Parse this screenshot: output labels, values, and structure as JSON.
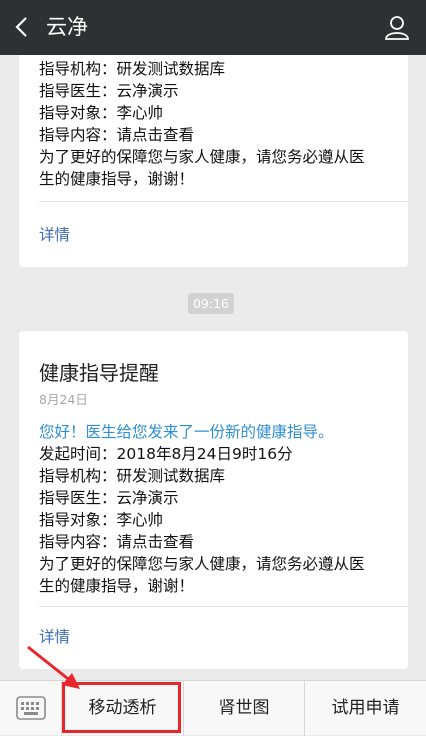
{
  "header": {
    "title": "云净"
  },
  "card1": {
    "lines": [
      "指导机构：研发测试数据库",
      "指导医生：云净演示",
      "指导对象：李心帅",
      "指导内容：请点击查看",
      "为了更好的保障您与家人健康，请您务必遵从医",
      "生的健康指导，谢谢！"
    ],
    "detail": "详情"
  },
  "timestamp": "09:16",
  "card2": {
    "title": "健康指导提醒",
    "date": "8月24日",
    "greeting": "您好！医生给您发来了一份新的健康指导。",
    "lines": [
      "发起时间：2018年8月24日9时16分",
      "指导机构：研发测试数据库",
      "指导医生：云净演示",
      "指导对象：李心帅",
      "指导内容：请点击查看",
      "为了更好的保障您与家人健康，请您务必遵从医",
      "生的健康指导，谢谢！"
    ],
    "detail": "详情"
  },
  "bottom_menu": {
    "items": [
      "移动透析",
      "肾世图",
      "试用申请"
    ]
  },
  "colors": {
    "header_bg": "#2f3033",
    "link": "#3c6cb8",
    "greeting": "#2e8fd6",
    "highlight": "#e8262b"
  },
  "icons": {
    "back": "chevron-left-icon",
    "user": "user-icon",
    "keyboard": "keyboard-icon"
  }
}
